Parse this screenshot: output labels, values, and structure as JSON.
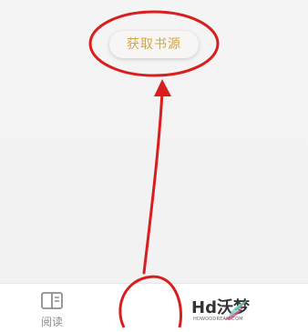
{
  "main": {
    "get_source_button": "获取书源"
  },
  "bottom_nav": {
    "items": [
      {
        "label": "阅读",
        "icon": "book-icon"
      }
    ]
  },
  "watermark": {
    "brand": "Hd沃梦",
    "url": "HDWOODREAM.COM"
  },
  "colors": {
    "accent": "#d7a53f",
    "annotation": "#d81e1e",
    "background": "#f3f3f3"
  }
}
